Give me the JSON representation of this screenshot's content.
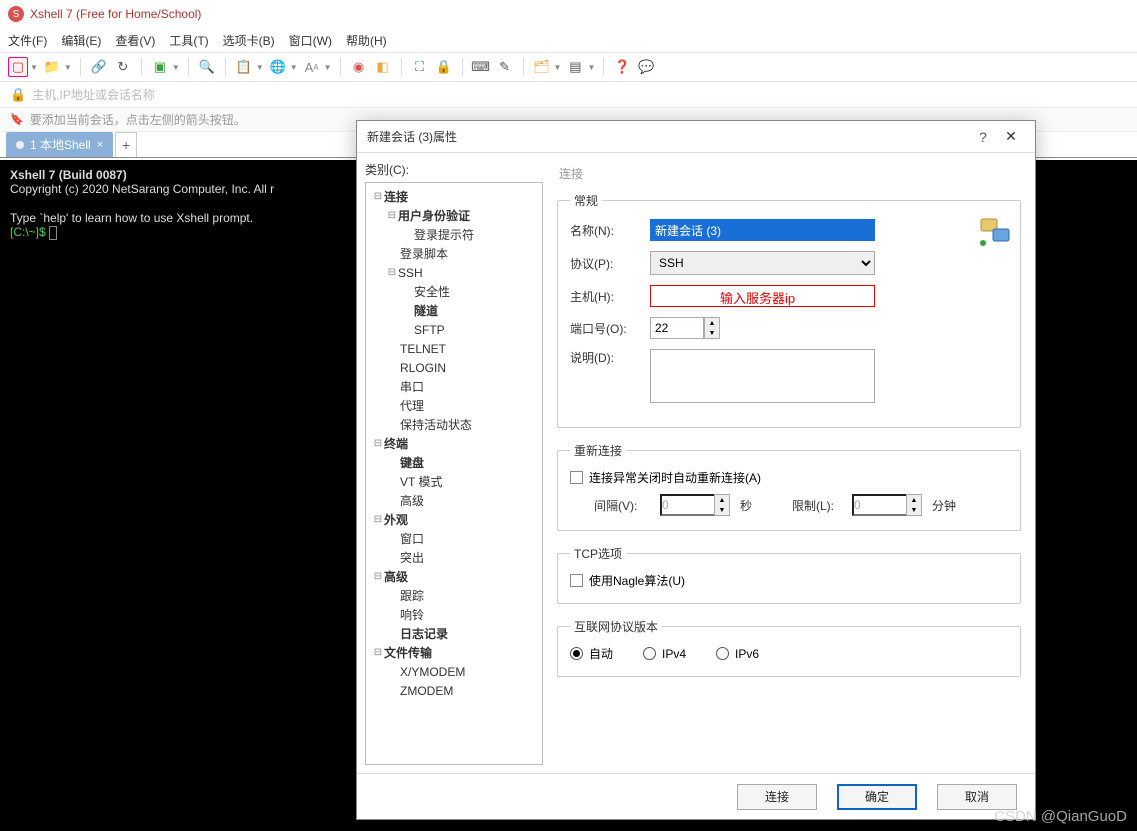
{
  "app": {
    "title": "Xshell 7 (Free for Home/School)"
  },
  "menu": {
    "file": "文件(F)",
    "edit": "编辑(E)",
    "view": "查看(V)",
    "tools": "工具(T)",
    "tabs": "选项卡(B)",
    "window": "窗口(W)",
    "help": "帮助(H)"
  },
  "addressbar": {
    "placeholder": "主机,IP地址或会话名称"
  },
  "hint": {
    "text": "要添加当前会话，点击左侧的箭头按钮。"
  },
  "tab": {
    "label": "1 本地Shell",
    "close": "×",
    "add": "+"
  },
  "terminal": {
    "line1": "Xshell 7 (Build 0087)",
    "line2": "Copyright (c) 2020 NetSarang Computer, Inc. All r",
    "line3": "Type `help' to learn how to use Xshell prompt.",
    "prompt": "[C:\\~]$ "
  },
  "dialog": {
    "title": "新建会话 (3)属性",
    "help": "?",
    "close": "✕",
    "treeLabel": "类别(C):",
    "tree": {
      "connection": "连接",
      "auth": "用户身份验证",
      "loginPrompt": "登录提示符",
      "loginScript": "登录脚本",
      "ssh": "SSH",
      "security": "安全性",
      "tunnel": "隧道",
      "sftp": "SFTP",
      "telnet": "TELNET",
      "rlogin": "RLOGIN",
      "serial": "串口",
      "proxy": "代理",
      "keepalive": "保持活动状态",
      "terminal": "终端",
      "keyboard": "键盘",
      "vt": "VT 模式",
      "advanced1": "高级",
      "appearance": "外观",
      "window": "窗口",
      "popup": "突出",
      "advanced2": "高级",
      "trace": "跟踪",
      "bell": "响铃",
      "logging": "日志记录",
      "fileTransfer": "文件传输",
      "xymodem": "X/YMODEM",
      "zmodem": "ZMODEM"
    },
    "section": "连接",
    "general": {
      "legend": "常规",
      "nameLabel": "名称(N):",
      "nameValue": "新建会话 (3)",
      "protocolLabel": "协议(P):",
      "protocolValue": "SSH",
      "hostLabel": "主机(H):",
      "hostValue": "",
      "hostAnnotation": "输入服务器ip",
      "portLabel": "端口号(O):",
      "portValue": "22",
      "descLabel": "说明(D):",
      "descValue": ""
    },
    "reconnect": {
      "legend": "重新连接",
      "checkbox": "连接异常关闭时自动重新连接(A)",
      "intervalLabel": "间隔(V):",
      "intervalValue": "0",
      "intervalUnit": "秒",
      "limitLabel": "限制(L):",
      "limitValue": "0",
      "limitUnit": "分钟"
    },
    "tcp": {
      "legend": "TCP选项",
      "nagle": "使用Nagle算法(U)"
    },
    "ipver": {
      "legend": "互联网协议版本",
      "auto": "自动",
      "ipv4": "IPv4",
      "ipv6": "IPv6"
    },
    "buttons": {
      "connect": "连接",
      "ok": "确定",
      "cancel": "取消"
    }
  },
  "watermark": "CSDN @QianGuoD"
}
